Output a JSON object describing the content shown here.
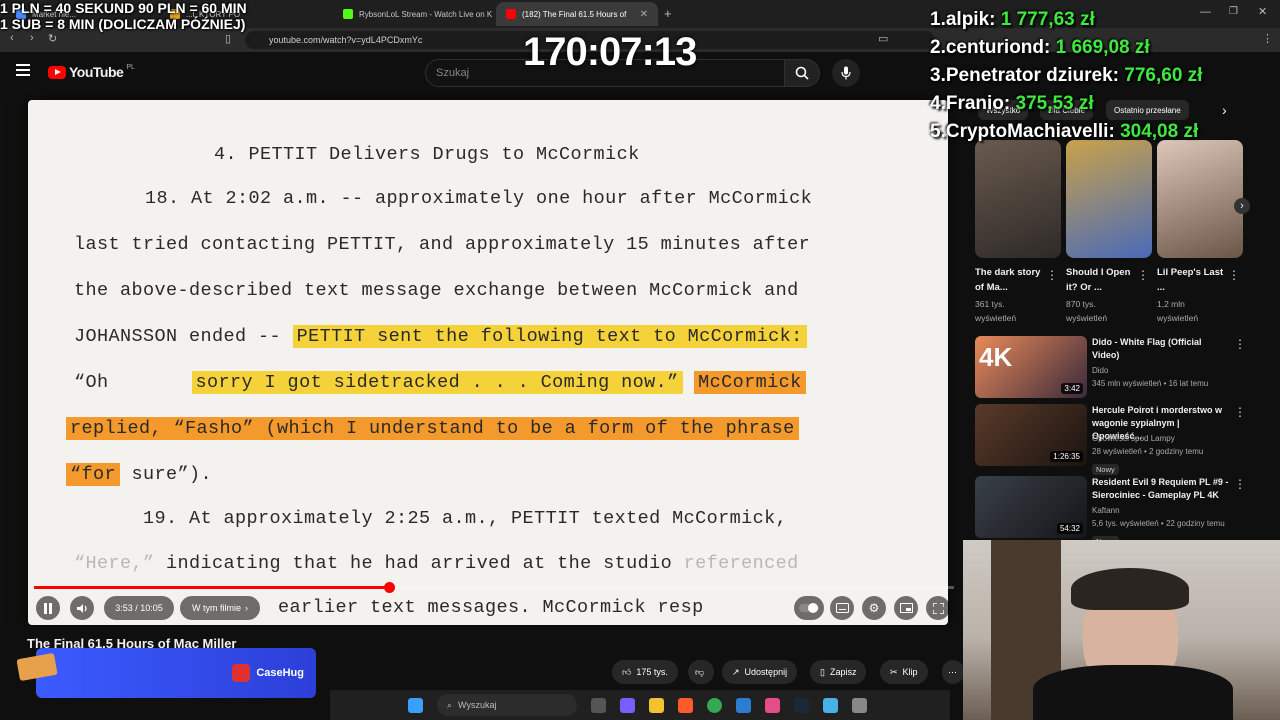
{
  "browser": {
    "tabs": [
      {
        "label": "Market nie...",
        "active": false
      },
      {
        "label": "...L KTÓRY PO",
        "active": false
      },
      {
        "label": "RybsonLoL Stream - Watch Live on K",
        "active": false
      },
      {
        "label": "(182) The Final 61.5 Hours of",
        "active": true
      }
    ],
    "url": "youtube.com/watch?v=ydL4PCDxmYc"
  },
  "youtube": {
    "logo_text": "YouTube",
    "region": "PL",
    "search_placeholder": "Szukaj"
  },
  "document": {
    "heading": "4.   PETTIT Delivers Drugs to McCormick",
    "para18_line1": "18.  At 2:02 a.m. -- approximately one hour after McCormick",
    "para18_line2": "last tried contacting PETTIT, and approximately 15 minutes after",
    "para18_line3": "the above-described text message exchange between McCormick and",
    "para18_line4_plain": "JOHANSSON ended --",
    "para18_line4_hl": "PETTIT sent the following text to McCormick:",
    "para18_line5_plain": "“Oh",
    "para18_line5_hl": "sorry I got sidetracked . . . Coming now.”",
    "para18_line5_hl2": "McCormick",
    "para18_line6_hl": "replied, “Fasho” (which I understand to be a form of the phrase",
    "para18_line7_hl": "“for",
    "para18_line7_plain": "sure”).",
    "para19_line1": "19.  At approximately 2:25 a.m., PETTIT texted McCormick,",
    "para19_line2_faded": "“Here,”",
    "para19_line2_plain": "indicating that he had arrived at the studio",
    "para19_line2_faded2": "referenced",
    "para19_line3": "earlier text messages.  McCormick resp"
  },
  "player": {
    "time": "3:53 / 10:05",
    "chapter": "W tym filmie",
    "progress": 0.386
  },
  "video": {
    "title": "The Final 61.5 Hours of Mac Miller",
    "likes": "175 tys.",
    "share": "Udostępnij",
    "save": "Zapisz",
    "clip": "Klip"
  },
  "ad": {
    "brand": "CaseHug"
  },
  "overlay": {
    "rule1": "1 PLN = 40 SEKUND 90 PLN = 60 MIN",
    "rule2": "1 SUB = 8 MIN (DOLICZAM PÓŹNIEJ)",
    "timer": "170:07:13",
    "leaderboard": [
      {
        "name": "1.alpik: ",
        "amount": "1 777,63 zł"
      },
      {
        "name": "2.centuriond: ",
        "amount": "1 669,08 zł"
      },
      {
        "name": "3.Penetrator dziurek: ",
        "amount": "776,60 zł"
      },
      {
        "name": "4.Franio: ",
        "amount": "375,53 zł"
      },
      {
        "name": "5.CryptoMachiavelli: ",
        "amount": "304,08 zł"
      }
    ]
  },
  "sidebar": {
    "chips": [
      "Wszystko",
      "Dla Ciebie",
      "Ostatnio przesłane"
    ],
    "shorts": [
      {
        "title": "The dark story of Ma...",
        "views": "361 tys.",
        "suffix": "wyświetleń"
      },
      {
        "title": "Should I Open it? Or ...",
        "views": "870 tys.",
        "suffix": "wyświetleń"
      },
      {
        "title": "Lil Peep's Last ...",
        "views": "1,2 mln",
        "suffix": "wyświetleń"
      }
    ],
    "related": [
      {
        "title": "Dido - White Flag (Official Video)",
        "channel": "Dido",
        "meta": "345 mln wyświetleń • 16 lat temu",
        "duration": "3:42",
        "badge": ""
      },
      {
        "title": "Hercule Poirot i morderstwo w wagonie sypialnym | Opowieść...",
        "channel": "Opowieści spod Lampy",
        "meta": "28 wyświetleń • 2 godziny temu",
        "duration": "1:26:35",
        "badge": "Nowy"
      },
      {
        "title": "Resident Evil 9 Requiem PL #9 - Sierociniec - Gameplay PL 4K",
        "channel": "Kaftann",
        "meta": "5,6 tys. wyświetleń • 22 godziny temu",
        "duration": "54:32",
        "badge": "Nowy"
      }
    ]
  },
  "taskbar": {
    "search": "Wyszukaj"
  },
  "colors": {
    "accent": "#ff0000",
    "highlight_yellow": "#f6d23a",
    "highlight_orange": "#f49a2c",
    "donation_green": "#3ee83e"
  }
}
